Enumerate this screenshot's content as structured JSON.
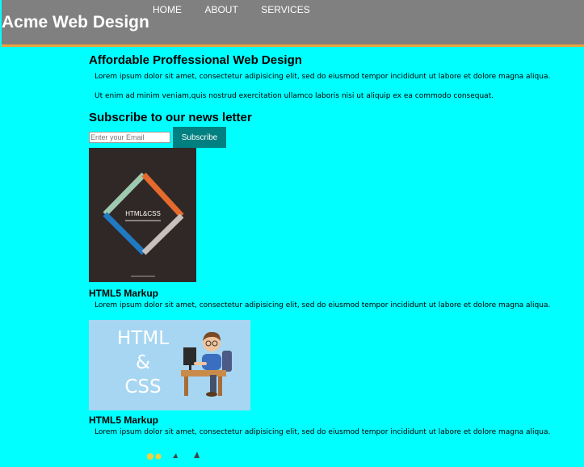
{
  "header": {
    "site_title": "Acme Web Design",
    "nav": [
      {
        "label": "HOME"
      },
      {
        "label": "ABOUT"
      },
      {
        "label": "SERVICES"
      }
    ]
  },
  "intro": {
    "heading": "Affordable Proffessional Web Design",
    "paragraphs": [
      "Lorem ipsum dolor sit amet, consectetur adipisicing elit, sed do eiusmod tempor incididunt ut labore et dolore magna aliqua.",
      "Ut enim ad minim veniam,quis nostrud exercitation ullamco laboris nisi ut aliquip ex ea commodo consequat."
    ]
  },
  "newsletter": {
    "heading": "Subscribe to our news letter",
    "email_placeholder": "Enter your Email",
    "subscribe_label": "Subscribe"
  },
  "cards": [
    {
      "title": "HTML5 Markup",
      "text": "Lorem ipsum dolor sit amet, consectetur adipisicing elit, sed do eiusmod tempor incididunt ut labore et dolore magna aliqua.",
      "image_text": "HTML&CSS"
    },
    {
      "title": "HTML5 Markup",
      "text": "Lorem ipsum dolor sit amet, consectetur adipisicing elit, sed do eiusmod tempor incididunt ut labore et dolore magna aliqua.",
      "image_text": [
        "HTML",
        "&",
        "CSS"
      ]
    }
  ],
  "colors": {
    "page_background": "#00ffff",
    "header_background": "#808080",
    "header_accent": "#e8a33c",
    "button_background": "#008080"
  },
  "icons": {
    "card1_image": "html-css-book-cover",
    "card2_image": "developer-at-desk-illustration"
  }
}
